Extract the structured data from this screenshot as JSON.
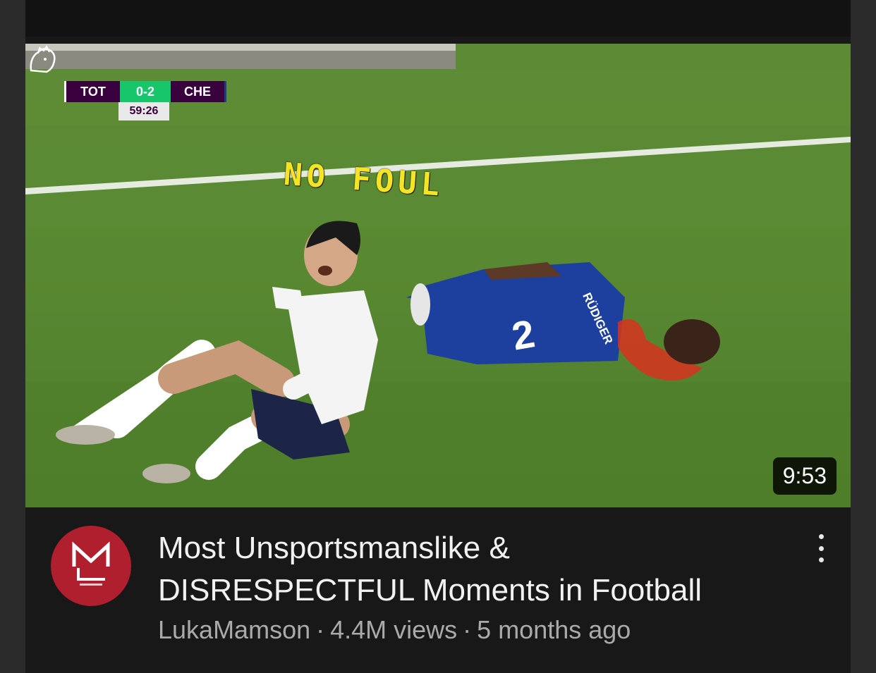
{
  "video": {
    "scoreboard": {
      "home_team": "TOT",
      "score": "0-2",
      "away_team": "CHE",
      "clock": "59:26"
    },
    "overlay_caption": "NO FOUL",
    "player_name_on_shirt": "RÜDIGER",
    "player_number": "2",
    "duration": "9:53"
  },
  "meta": {
    "channel_avatar_letter": "M",
    "title_line1": "Most Unsportsmanslike &",
    "title_line2": "DISRESPECTFUL Moments in Football",
    "channel": "LukaMamson",
    "views": "4.4M views",
    "age": "5 months ago",
    "separator": "·"
  },
  "colors": {
    "pitch": "#5a8a33",
    "accent_red": "#b01f2d",
    "caption_yellow": "#f5e325",
    "background": "#181818"
  },
  "icons": {
    "menu": "kebab-menu-icon",
    "league": "premier-league-lion-icon"
  }
}
